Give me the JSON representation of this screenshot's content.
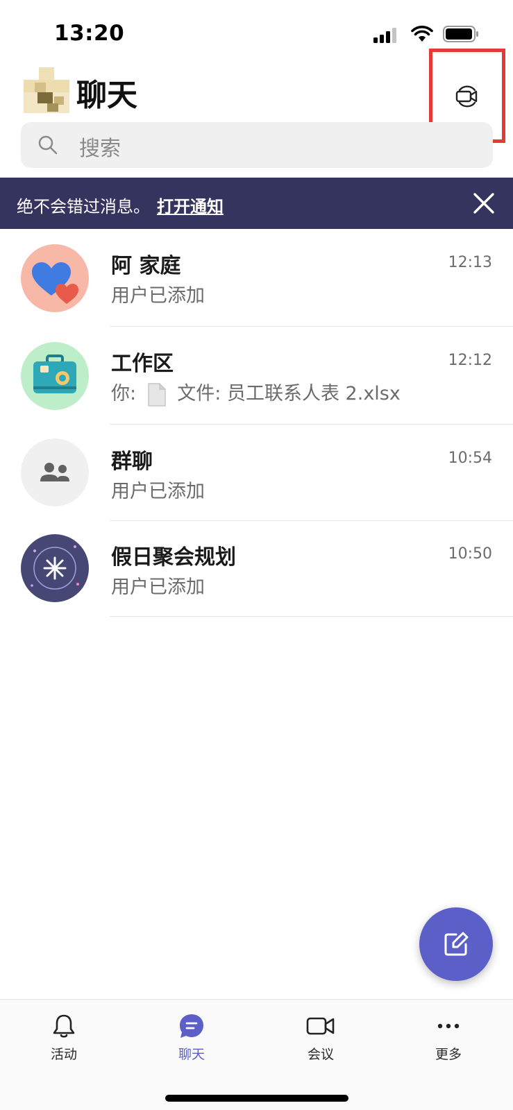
{
  "status_bar": {
    "time": "13:20"
  },
  "header": {
    "title": "聊天"
  },
  "search": {
    "placeholder": "搜索"
  },
  "banner": {
    "text": "绝不会错过消息。",
    "link": "打开通知"
  },
  "chats": [
    {
      "name": "阿 家庭",
      "preview": "用户已添加",
      "time": "12:13",
      "avatar_icon": "hearts-icon",
      "avatar_color": "#f7b8a8"
    },
    {
      "name": "工作区",
      "preview_prefix": "你:",
      "preview": "文件: 员工联系人表 2.xlsx",
      "time": "12:12",
      "avatar_icon": "suitcase-icon",
      "avatar_color": "#bdeec9"
    },
    {
      "name": "群聊",
      "preview": "用户已添加",
      "time": "10:54",
      "avatar_icon": "people-icon",
      "avatar_color": "#f0f0f0"
    },
    {
      "name": "假日聚会规划",
      "preview": "用户已添加",
      "time": "10:50",
      "avatar_icon": "sparkle-icon",
      "avatar_color": "#464775"
    }
  ],
  "bottom_nav": [
    {
      "label": "活动",
      "icon": "bell-icon"
    },
    {
      "label": "聊天",
      "icon": "chat-icon",
      "active": true
    },
    {
      "label": "会议",
      "icon": "video-icon"
    },
    {
      "label": "更多",
      "icon": "more-icon"
    }
  ],
  "colors": {
    "accent": "#5b5fc7",
    "banner": "#34345e",
    "highlight": "#e53935"
  }
}
